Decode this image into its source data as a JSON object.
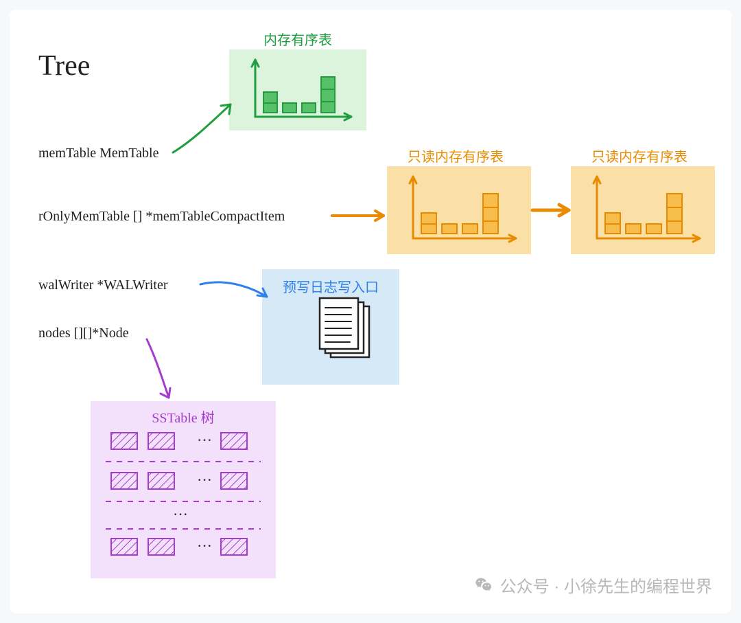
{
  "title": "Tree",
  "fields": {
    "memTable": "memTable  MemTable",
    "rOnlyMemTable": "rOnlyMemTable  [] *memTableCompactItem",
    "walWriter": "walWriter  *WALWriter",
    "nodes": "nodes  [][]*Node"
  },
  "captions": {
    "memTable": "内存有序表",
    "readOnly": "只读内存有序表",
    "wal": "预写日志写入口",
    "sstable": "SSTable 树"
  },
  "watermark": "公众号 · 小徐先生的编程世界",
  "colors": {
    "green": "#1e9e3e",
    "orange": "#e88b00",
    "blue": "#2f80ed",
    "purple": "#a63ccf",
    "black": "#222"
  }
}
